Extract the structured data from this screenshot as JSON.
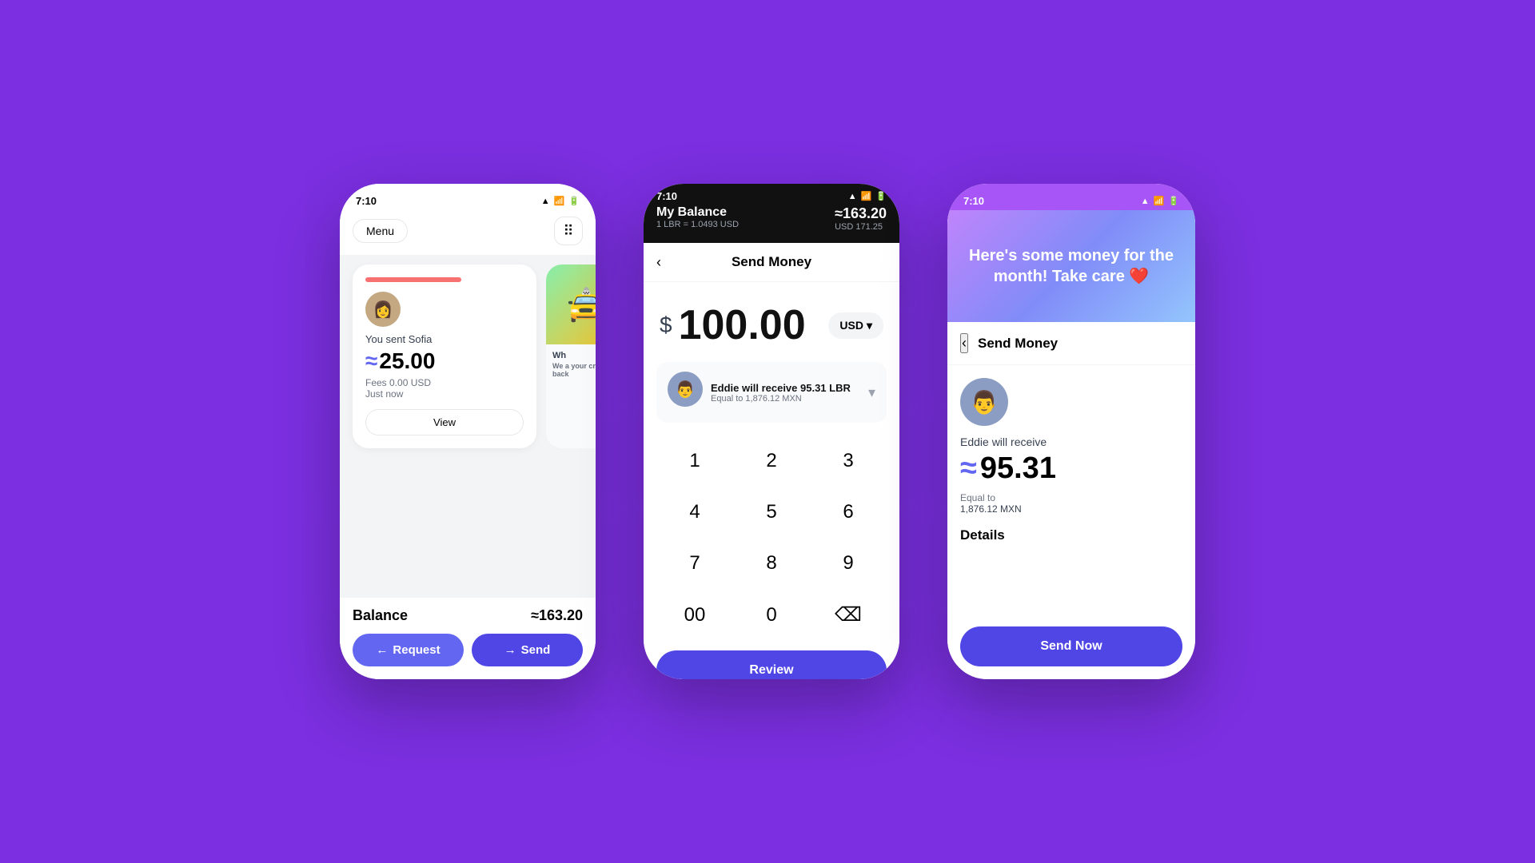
{
  "background": "#7B2FE0",
  "phone1": {
    "status": {
      "time": "7:10",
      "signal": "▲",
      "wifi": "WiFi",
      "battery": "Battery"
    },
    "header": {
      "menu_label": "Menu",
      "qr_icon": "⠿"
    },
    "transaction": {
      "you_sent": "You sent Sofia",
      "amount": "25.00",
      "fees": "Fees 0.00 USD",
      "time": "Just now",
      "view_label": "View"
    },
    "second_card": {
      "icon": "🚖",
      "title": "Wh",
      "subtitle": "We a your cryp back"
    },
    "footer": {
      "balance_label": "Balance",
      "balance_amount": "≈163.20",
      "request_label": "Request",
      "send_label": "Send"
    }
  },
  "phone2": {
    "status": {
      "time": "7:10",
      "signal": "▲",
      "battery": "Battery"
    },
    "balance_header": {
      "label": "My Balance",
      "amount": "≈163.20",
      "rate": "1 LBR = 1.0493 USD",
      "usd": "USD 171.25"
    },
    "send_money": {
      "back": "‹",
      "title": "Send Money",
      "amount": "100.00",
      "dollar": "$",
      "currency": "USD",
      "recipient": "Eddie will receive 95.31 LBR",
      "equivalent": "Equal to 1,876.12 MXN",
      "review_label": "Review"
    },
    "numpad": {
      "keys": [
        "1",
        "2",
        "3",
        "4",
        "5",
        "6",
        "7",
        "8",
        "9",
        "00",
        "0",
        "⌫"
      ]
    }
  },
  "phone3": {
    "status": {
      "time": "7:10",
      "signal": "▲",
      "battery": "Battery"
    },
    "hero": {
      "message": "Here's some money for the month! Take care ❤️"
    },
    "send_money": {
      "back": "‹",
      "title": "Send Money",
      "will_receive": "Eddie will receive",
      "amount": "95.31",
      "equal_to": "Equal to",
      "mxn_amount": "1,876.12 MXN",
      "details_title": "Details",
      "send_now_label": "Send Now"
    }
  }
}
